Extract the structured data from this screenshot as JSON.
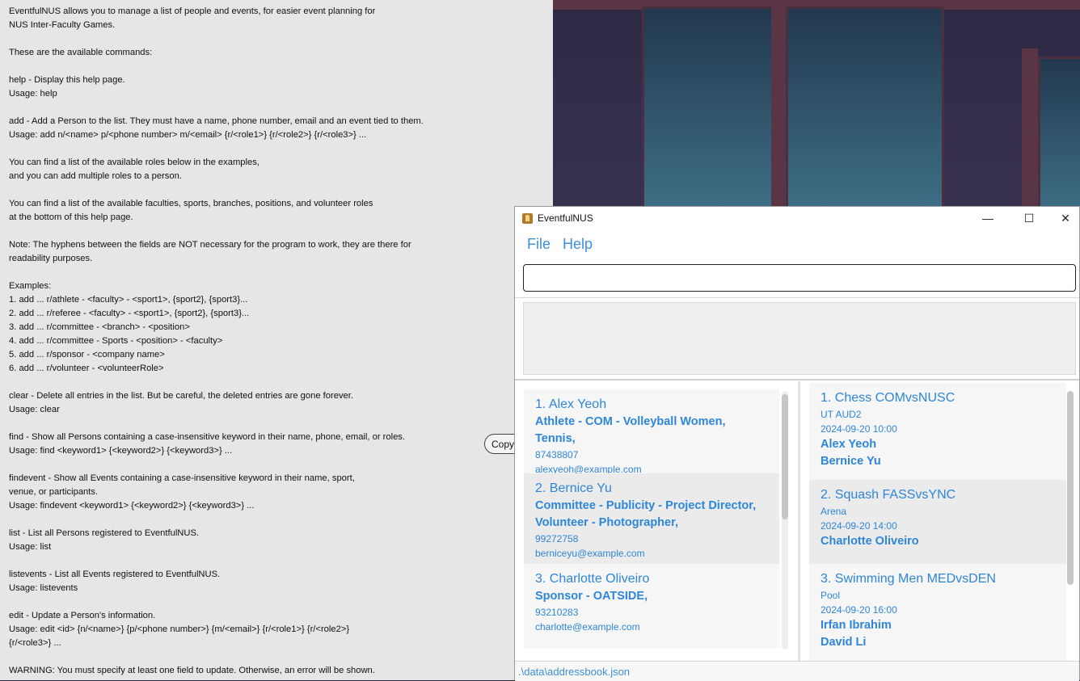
{
  "help": {
    "lines": [
      "EventfulNUS allows you to manage a list of people and events, for easier event planning for",
      "NUS Inter-Faculty Games.",
      "",
      "These are the available commands:",
      "",
      "help - Display this help page.",
      "Usage: help",
      "",
      "add - Add a Person to the list. They must have a name, phone number, email and an event tied to them.",
      "Usage: add n/<name> p/<phone number> m/<email> {r/<role1>} {r/<role2>} {r/<role3>} ...",
      "",
      "You can find a list of the available roles below in the examples,",
      "and you can add multiple roles to a person.",
      "",
      "You can find a list of the available faculties, sports, branches, positions, and volunteer roles",
      "at the bottom of this help page.",
      "",
      "Note: The hyphens between the fields are NOT necessary for the program to work, they are there for",
      "readability purposes.",
      "",
      "Examples:",
      "1. add ... r/athlete - <faculty> - <sport1>, {sport2}, {sport3}...",
      "2. add ... r/referee - <faculty> - <sport1>, {sport2}, {sport3}...",
      "3. add ... r/committee - <branch> - <position>",
      "4. add ... r/committee - Sports - <position> - <faculty>",
      "5. add ... r/sponsor - <company name>",
      "6. add ... r/volunteer - <volunteerRole>",
      "",
      "clear - Delete all entries in the list. But be careful, the deleted entries are gone forever.",
      "Usage: clear",
      "",
      "find - Show all Persons containing a case-insensitive keyword in their name, phone, email, or roles.",
      "Usage: find <keyword1> {<keyword2>} {<keyword3>} ...",
      "",
      "findevent - Show all Events containing a case-insensitive keyword in their name, sport,",
      "venue, or participants.",
      "Usage: findevent <keyword1> {<keyword2>} {<keyword3>} ...",
      "",
      "list - List all Persons registered to EventfulNUS.",
      "Usage: list",
      "",
      "listevents - List all Events registered to EventfulNUS.",
      "Usage: listevents",
      "",
      "edit - Update a Person's information.",
      "Usage: edit <id> {n/<name>} {p/<phone number>} {m/<email>} {r/<role1>} {r/<role2>}",
      "{r/<role3>} ...",
      "",
      "WARNING: You must specify at least one field to update. Otherwise, an error will be shown."
    ],
    "copy_label": "Copy"
  },
  "window": {
    "title": "EventfulNUS",
    "minimize": "—",
    "maximize": "☐",
    "close": "✕"
  },
  "menu": {
    "file": "File",
    "help": "Help"
  },
  "command": {
    "value": ""
  },
  "persons": [
    {
      "name": "1. Alex Yeoh",
      "roles": [
        "Athlete - COM - Volleyball Women, Tennis,"
      ],
      "phone": "87438807",
      "email": "alexyeoh@example.com"
    },
    {
      "name": "2. Bernice Yu",
      "roles": [
        "Committee - Publicity - Project Director,",
        "Volunteer - Photographer,"
      ],
      "phone": "99272758",
      "email": "berniceyu@example.com"
    },
    {
      "name": "3. Charlotte Oliveiro",
      "roles": [
        "Sponsor - OATSIDE,"
      ],
      "phone": "93210283",
      "email": "charlotte@example.com"
    }
  ],
  "events": [
    {
      "name": "1. Chess COMvsNUSC",
      "venue": "UT AUD2",
      "time": "2024-09-20 10:00",
      "participants": [
        "Alex Yeoh",
        "Bernice Yu"
      ]
    },
    {
      "name": "2. Squash FASSvsYNC",
      "venue": "Arena",
      "time": "2024-09-20 14:00",
      "participants": [
        "Charlotte Oliveiro"
      ]
    },
    {
      "name": "3. Swimming Men MEDvsDEN",
      "venue": "Pool",
      "time": "2024-09-20 16:00",
      "participants": [
        "Irfan Ibrahim",
        "David Li"
      ]
    }
  ],
  "status": {
    "path": ".\\data\\addressbook.json"
  }
}
